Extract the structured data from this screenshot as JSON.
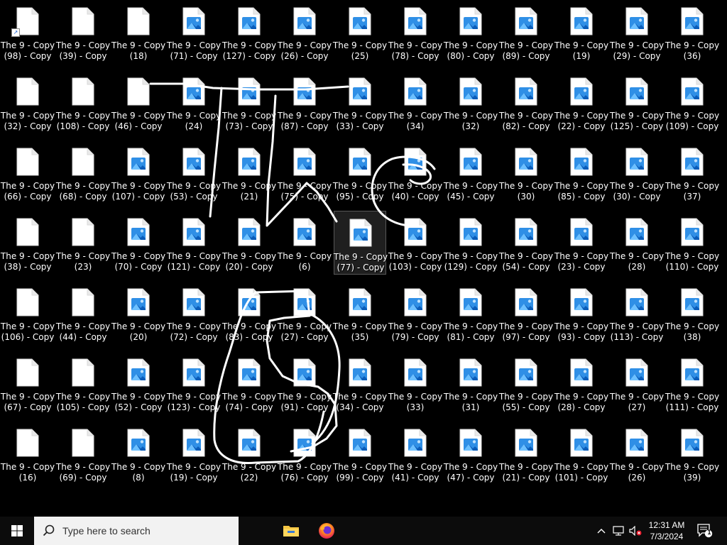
{
  "desktop": {
    "icons": [
      {
        "label": "The 9 - Copy\n(98) - Copy",
        "type": "blank",
        "shortcut": true
      },
      {
        "label": "The 9 - Copy\n(39) - Copy",
        "type": "blank"
      },
      {
        "label": "The 9 - Copy\n(18)",
        "type": "blank"
      },
      {
        "label": "The 9 - Copy\n(71) - Copy",
        "type": "image"
      },
      {
        "label": "The 9 - Copy\n(127) - Copy",
        "type": "image"
      },
      {
        "label": "The 9 - Copy\n(26) - Copy",
        "type": "image"
      },
      {
        "label": "The 9 - Copy\n(25)",
        "type": "image"
      },
      {
        "label": "The 9 - Copy\n(78) - Copy",
        "type": "image"
      },
      {
        "label": "The 9 - Copy\n(80) - Copy",
        "type": "image"
      },
      {
        "label": "The 9 - Copy\n(89) - Copy",
        "type": "image"
      },
      {
        "label": "The 9 - Copy\n(19)",
        "type": "image"
      },
      {
        "label": "The 9 - Copy\n(29) - Copy",
        "type": "image"
      },
      {
        "label": "The 9 - Copy\n(36)",
        "type": "image"
      },
      {
        "label": "The 9 - Copy\n(32) - Copy",
        "type": "blank"
      },
      {
        "label": "The 9 - Copy\n(108) - Copy",
        "type": "blank"
      },
      {
        "label": "The 9 - Copy\n(46) - Copy",
        "type": "blank"
      },
      {
        "label": "The 9 - Copy\n(24)",
        "type": "image"
      },
      {
        "label": "The 9 - Copy\n(73) - Copy",
        "type": "image"
      },
      {
        "label": "The 9 - Copy\n(87) - Copy",
        "type": "image"
      },
      {
        "label": "The 9 - Copy\n(33) - Copy",
        "type": "image"
      },
      {
        "label": "The 9 - Copy\n(34)",
        "type": "image"
      },
      {
        "label": "The 9 - Copy\n(32)",
        "type": "image"
      },
      {
        "label": "The 9 - Copy\n(82) - Copy",
        "type": "image"
      },
      {
        "label": "The 9 - Copy\n(22) - Copy",
        "type": "image"
      },
      {
        "label": "The 9 - Copy\n(125) - Copy",
        "type": "image"
      },
      {
        "label": "The 9 - Copy\n(109) - Copy",
        "type": "image"
      },
      {
        "label": "The 9 - Copy\n(66) - Copy",
        "type": "blank"
      },
      {
        "label": "The 9 - Copy\n(68) - Copy",
        "type": "blank"
      },
      {
        "label": "The 9 - Copy\n(107) - Copy",
        "type": "image"
      },
      {
        "label": "The 9 - Copy\n(53) - Copy",
        "type": "image"
      },
      {
        "label": "The 9 - Copy\n(21)",
        "type": "image"
      },
      {
        "label": "The 9 - Copy\n(75) - Copy",
        "type": "image"
      },
      {
        "label": "The 9 - Copy\n(95) - Copy",
        "type": "image"
      },
      {
        "label": "The 9 - Copy\n(40) - Copy",
        "type": "image"
      },
      {
        "label": "The 9 - Copy\n(45) - Copy",
        "type": "image"
      },
      {
        "label": "The 9 - Copy\n(30)",
        "type": "image"
      },
      {
        "label": "The 9 - Copy\n(85) - Copy",
        "type": "image"
      },
      {
        "label": "The 9 - Copy\n(30) - Copy",
        "type": "image"
      },
      {
        "label": "The 9 - Copy\n(37)",
        "type": "image"
      },
      {
        "label": "The 9 - Copy\n(38) - Copy",
        "type": "blank"
      },
      {
        "label": "The 9 - Copy\n(23)",
        "type": "blank"
      },
      {
        "label": "The 9 - Copy\n(70) - Copy",
        "type": "image"
      },
      {
        "label": "The 9 - Copy\n(121) - Copy",
        "type": "image"
      },
      {
        "label": "The 9 - Copy\n(20) - Copy",
        "type": "image"
      },
      {
        "label": "The 9 - Copy\n(6)",
        "type": "image"
      },
      {
        "label": "The 9 - Copy\n(77) - Copy",
        "type": "image",
        "selected": true
      },
      {
        "label": "The 9 - Copy\n(103) - Copy",
        "type": "image"
      },
      {
        "label": "The 9 - Copy\n(129) - Copy",
        "type": "image"
      },
      {
        "label": "The 9 - Copy\n(54) - Copy",
        "type": "image"
      },
      {
        "label": "The 9 - Copy\n(23) - Copy",
        "type": "image"
      },
      {
        "label": "The 9 - Copy\n(28)",
        "type": "image"
      },
      {
        "label": "The 9 - Copy\n(110) - Copy",
        "type": "image"
      },
      {
        "label": "The 9 - Copy\n(106) - Copy",
        "type": "blank"
      },
      {
        "label": "The 9 - Copy\n(44) - Copy",
        "type": "blank"
      },
      {
        "label": "The 9 - Copy\n(20)",
        "type": "image"
      },
      {
        "label": "The 9 - Copy\n(72) - Copy",
        "type": "image"
      },
      {
        "label": "The 9 - Copy\n(83) - Copy",
        "type": "image"
      },
      {
        "label": "The 9 - Copy\n(27) - Copy",
        "type": "image"
      },
      {
        "label": "The 9 - Copy\n(35)",
        "type": "image"
      },
      {
        "label": "The 9 - Copy\n(79) - Copy",
        "type": "image"
      },
      {
        "label": "The 9 - Copy\n(81) - Copy",
        "type": "image"
      },
      {
        "label": "The 9 - Copy\n(97) - Copy",
        "type": "image"
      },
      {
        "label": "The 9 - Copy\n(93) - Copy",
        "type": "image"
      },
      {
        "label": "The 9 - Copy\n(113) - Copy",
        "type": "image"
      },
      {
        "label": "The 9 - Copy\n(38)",
        "type": "image"
      },
      {
        "label": "The 9 - Copy\n(67) - Copy",
        "type": "blank"
      },
      {
        "label": "The 9 - Copy\n(105) - Copy",
        "type": "blank"
      },
      {
        "label": "The 9 - Copy\n(52) - Copy",
        "type": "image"
      },
      {
        "label": "The 9 - Copy\n(123) - Copy",
        "type": "image"
      },
      {
        "label": "The 9 - Copy\n(74) - Copy",
        "type": "image"
      },
      {
        "label": "The 9 - Copy\n(91) - Copy",
        "type": "image"
      },
      {
        "label": "The 9 - Copy\n(34) - Copy",
        "type": "image"
      },
      {
        "label": "The 9 - Copy\n(33)",
        "type": "image"
      },
      {
        "label": "The 9 - Copy\n(31)",
        "type": "image"
      },
      {
        "label": "The 9 - Copy\n(55) - Copy",
        "type": "image"
      },
      {
        "label": "The 9 - Copy\n(28) - Copy",
        "type": "image"
      },
      {
        "label": "The 9 - Copy\n(27)",
        "type": "image"
      },
      {
        "label": "The 9 - Copy\n(111) - Copy",
        "type": "image"
      },
      {
        "label": "The 9 - Copy\n(16)",
        "type": "blank"
      },
      {
        "label": "The 9 - Copy\n(69) - Copy",
        "type": "blank"
      },
      {
        "label": "The 9 - Copy\n(8)",
        "type": "image"
      },
      {
        "label": "The 9 - Copy\n(19) - Copy",
        "type": "image"
      },
      {
        "label": "The 9 - Copy\n(22)",
        "type": "image"
      },
      {
        "label": "The 9 - Copy\n(76) - Copy",
        "type": "image"
      },
      {
        "label": "The 9 - Copy\n(99) - Copy",
        "type": "image"
      },
      {
        "label": "The 9 - Copy\n(41) - Copy",
        "type": "image"
      },
      {
        "label": "The 9 - Copy\n(47) - Copy",
        "type": "image"
      },
      {
        "label": "The 9 - Copy\n(21) - Copy",
        "type": "image"
      },
      {
        "label": "The 9 - Copy\n(101) - Copy",
        "type": "image"
      },
      {
        "label": "The 9 - Copy\n(26)",
        "type": "image"
      },
      {
        "label": "The 9 - Copy\n(39)",
        "type": "image"
      }
    ],
    "columns": 13
  },
  "taskbar": {
    "search_placeholder": "Type here to search",
    "start_icon": "windows-logo-icon",
    "search_icon": "search-icon",
    "pinned": [
      {
        "name": "file-explorer-icon"
      },
      {
        "name": "firefox-icon"
      }
    ],
    "tray": {
      "clock_time": "12:31 AM",
      "clock_date": "7/3/2024",
      "notification_count": "1",
      "icons": [
        "chevron-up-icon",
        "network-icon",
        "volume-muted-icon",
        "notification-icon"
      ]
    }
  },
  "colors": {
    "desktop_bg": "#000000",
    "taskbar_bg": "#0c0c0c",
    "search_bg": "#f2f2f2",
    "image_icon_blue": "#2f8fe6",
    "scribble": "#ffffff"
  }
}
